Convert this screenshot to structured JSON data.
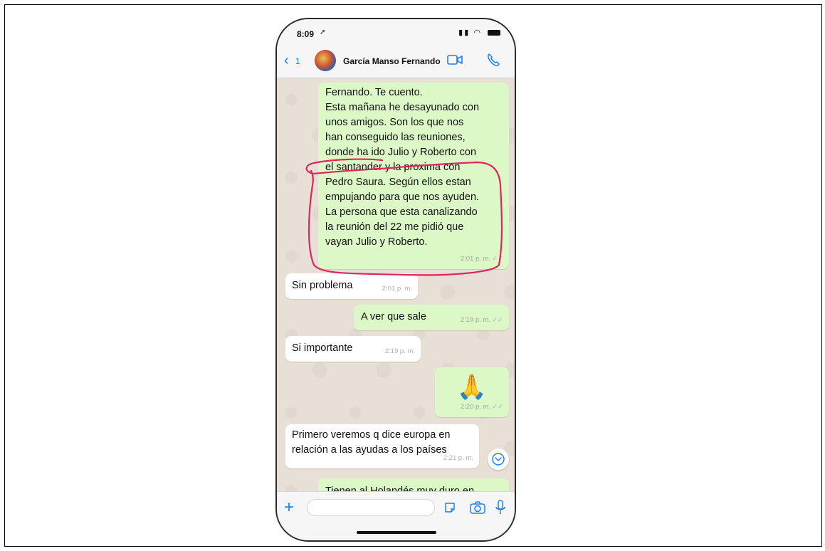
{
  "status": {
    "time": "8:09",
    "location_glyph": "➚"
  },
  "header": {
    "back_count": "1",
    "contact_name": "García Manso Fernando"
  },
  "messages": [
    {
      "direction": "out",
      "text": "Fernando.  Te cuento.\nEsta mañana he desayunado con\nunos amigos.   Son los que nos\nhan conseguido las reuniones,\ndonde ha ido Julio y Roberto con\nel santander y la proxima con\nPedro Saura.   Según ellos estan\nempujando para que nos ayuden.\nLa persona que esta canalizando\nla reunión del 22 me pidió que\nvayan Julio y Roberto.",
      "time": "2:01 p. m.",
      "ticks": "✓✓"
    },
    {
      "direction": "in",
      "text": "Sin problema",
      "time": "2:01 p. m."
    },
    {
      "direction": "out",
      "text": "A ver que sale",
      "time": "2:19 p. m.",
      "ticks": "✓✓"
    },
    {
      "direction": "in",
      "text": "Si importante",
      "time": "2:19 p. m."
    },
    {
      "direction": "out",
      "text": "🙏",
      "time": "2:20 p. m.",
      "ticks": "✓✓"
    },
    {
      "direction": "in",
      "text": "Primero veremos q dice europa en\nrelación a las ayudas a los países",
      "time": "2:21 p. m."
    },
    {
      "direction": "out",
      "text": "Tienen al Holandés muy duro en"
    }
  ],
  "composer": {
    "value": ""
  },
  "colors": {
    "accent": "#1b7ffb",
    "outgoing_bubble": "#dcf8c6",
    "incoming_bubble": "#ffffff",
    "annotation": "#e0245e"
  },
  "icons": {
    "back": "chevron-left-icon",
    "video": "video-camera-icon",
    "call": "phone-icon",
    "scroll": "chevron-down-circle-icon",
    "add": "plus-icon",
    "sticker": "sticker-icon",
    "camera": "camera-icon",
    "mic": "microphone-icon"
  }
}
